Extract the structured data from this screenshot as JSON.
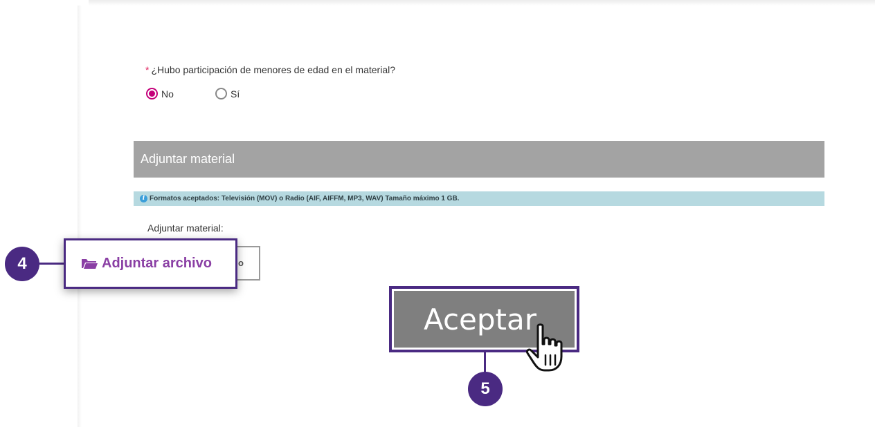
{
  "form": {
    "question_required_mark": "*",
    "question": "¿Hubo participación de menores de edad en el material?",
    "radio_options": [
      {
        "label": "No",
        "checked": true
      },
      {
        "label": "Sí",
        "checked": false
      }
    ]
  },
  "attach_section": {
    "header": "Adjuntar material",
    "info_icon": "info-icon",
    "info_text": "Formatos aceptados: Televisión (MOV) o Radio (AIF, AIFFM, MP3, WAV) Tamaño máximo 1 GB.",
    "field_label": "Adjuntar material:",
    "file_button_partial": "o"
  },
  "callouts": {
    "step4_number": "4",
    "step4_label": "Adjuntar archivo",
    "step4_icon": "folder-open-icon",
    "step5_number": "5"
  },
  "actions": {
    "accept_label": "Aceptar",
    "cursor_icon": "hand-pointer-icon"
  },
  "colors": {
    "accent_purple": "#4a2a82",
    "radio_checked": "#c4007a",
    "callout_text": "#8a3fa4",
    "section_header_bg": "#a3a3a3",
    "info_bar_bg": "#b6d9e0",
    "accept_button_bg": "#7f7f7f"
  }
}
